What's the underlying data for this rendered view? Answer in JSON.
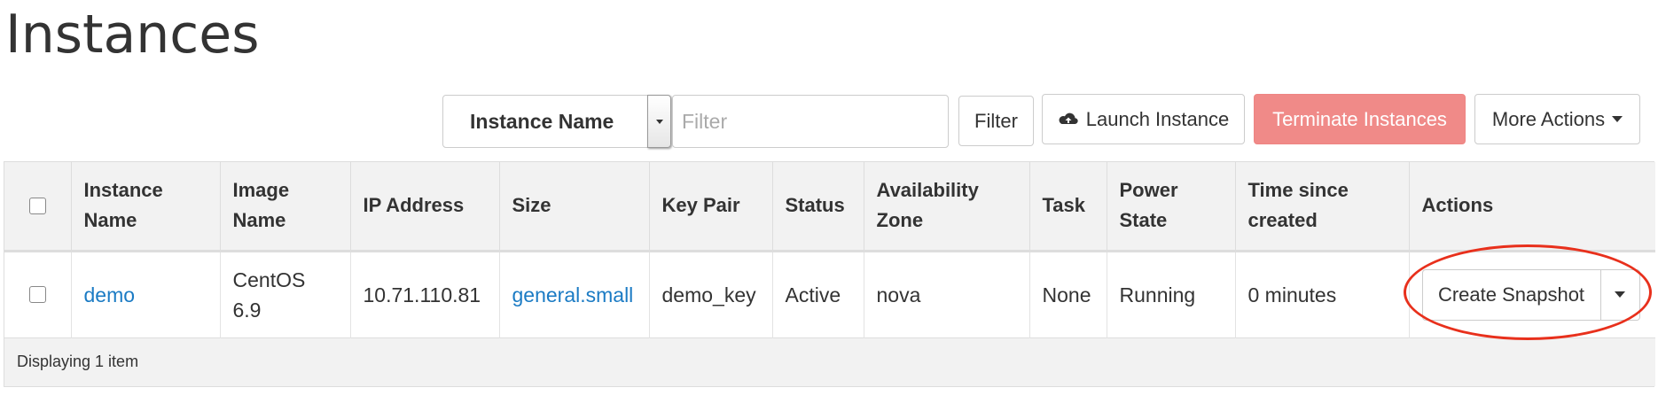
{
  "page": {
    "title": "Instances"
  },
  "toolbar": {
    "filter_field_selected": "Instance Name",
    "filter_placeholder": "Filter",
    "filter_button": "Filter",
    "launch_button": "Launch Instance",
    "terminate_button": "Terminate Instances",
    "more_actions_button": "More Actions"
  },
  "table": {
    "headers": [
      "Instance Name",
      "Image Name",
      "IP Address",
      "Size",
      "Key Pair",
      "Status",
      "Availability Zone",
      "Task",
      "Power State",
      "Time since created",
      "Actions"
    ],
    "rows": [
      {
        "instance_name": "demo",
        "image_name": "CentOS 6.9",
        "ip_address": "10.71.110.81",
        "size": "general.small",
        "key_pair": "demo_key",
        "status": "Active",
        "availability_zone": "nova",
        "task": "None",
        "power_state": "Running",
        "time_since_created": "0 minutes",
        "action_label": "Create Snapshot"
      }
    ],
    "footer": "Displaying 1 item"
  },
  "colors": {
    "link": "#1b7bc4",
    "danger_button": "#f08a88",
    "highlight_annotation": "#e8301c",
    "header_bg": "#f2f2f2"
  },
  "icons": {
    "launch": "cloud-upload-icon",
    "dropdown": "caret-down-icon"
  }
}
